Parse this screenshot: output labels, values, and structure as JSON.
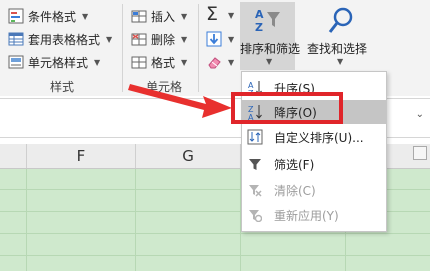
{
  "ribbon": {
    "styles": {
      "conditional_formatting": "条件格式",
      "format_as_table": "套用表格格式",
      "cell_styles": "单元格样式",
      "label": "样式"
    },
    "cells": {
      "insert": "插入",
      "delete": "删除",
      "format": "格式",
      "label": "单元格"
    },
    "editing": {
      "sort_filter": "排序和筛选",
      "find_select": "查找和选择"
    }
  },
  "columns": [
    "F",
    "G"
  ],
  "sort_menu": {
    "items": [
      {
        "label": "升序(S)",
        "icon": "sort-ascending-icon",
        "state": "partially-hidden"
      },
      {
        "label": "降序(O)",
        "icon": "sort-descending-icon",
        "state": "highlighted"
      },
      {
        "label": "自定义排序(U)...",
        "icon": "custom-sort-icon",
        "state": "enabled"
      },
      {
        "label": "筛选(F)",
        "icon": "filter-icon",
        "state": "enabled"
      },
      {
        "label": "清除(C)",
        "icon": "clear-filter-icon",
        "state": "disabled"
      },
      {
        "label": "重新应用(Y)",
        "icon": "reapply-icon",
        "state": "disabled"
      }
    ]
  },
  "colors": {
    "highlight_box": "#e0252a",
    "arrow": "#e8302e",
    "grid_fill": "#cfe9cd",
    "menu_hover": "#c5c5c5"
  }
}
